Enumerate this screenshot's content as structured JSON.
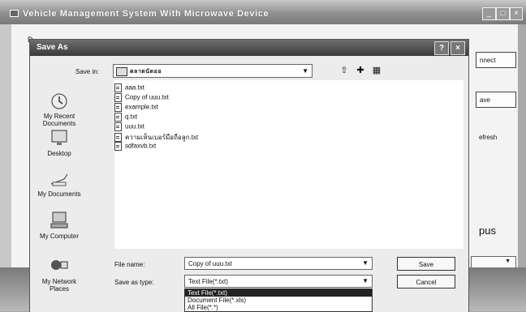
{
  "background_window": {
    "title": "Vehicle Management System With Microwave Device",
    "buttons": [
      "nnect",
      "ave",
      "efresh"
    ],
    "partial_letter": "D",
    "partial_text": "pus"
  },
  "dialog": {
    "title": "Save As",
    "save_in_label": "Save in:",
    "save_in_value": "ตลาดนัดออ",
    "places": [
      "My Recent Documents",
      "Desktop",
      "My Documents",
      "My Computer",
      "My Network Places"
    ],
    "files": [
      "aaa.txt",
      "Copy of uuu.txt",
      "example.txt",
      "q.txt",
      "uuu.txt",
      "ความเห็นเบอร์มือถือลูก.txt",
      "sdfaxvb.txt"
    ],
    "file_name_label": "File name:",
    "file_name_value": "Copy of uuu.txt",
    "save_type_label": "Save as type:",
    "save_type_value": "Text File(*.txt)",
    "type_options": [
      "Text File(*.txt)",
      "Document File(*.xls)",
      "All File(*.*)"
    ],
    "save_button": "Save",
    "cancel_button": "Cancel"
  },
  "colors": {
    "dialog_title_bar": "#4a4a4a",
    "selection": "#222222"
  }
}
